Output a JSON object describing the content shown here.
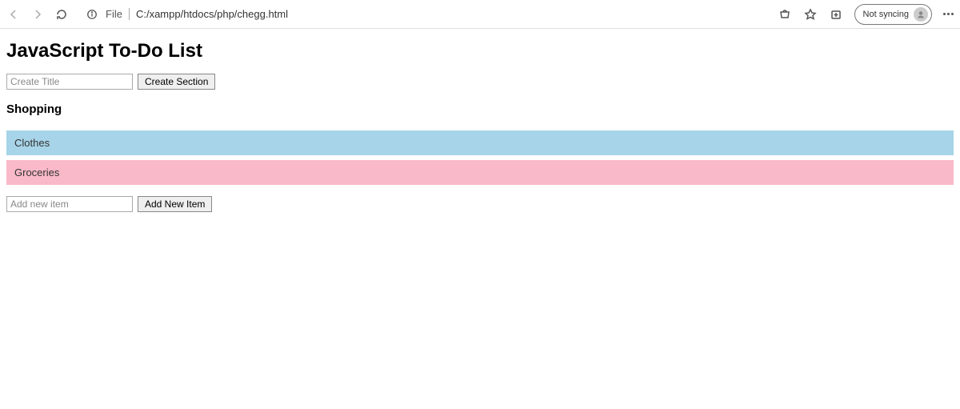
{
  "browser": {
    "url_prefix": "File",
    "url_path": "C:/xampp/htdocs/php/chegg.html",
    "sync_label": "Not syncing"
  },
  "page": {
    "title": "JavaScript To-Do List",
    "create_title_placeholder": "Create Title",
    "create_section_button": "Create Section",
    "section_title": "Shopping",
    "items": [
      {
        "label": "Clothes",
        "color": "blue"
      },
      {
        "label": "Groceries",
        "color": "pink"
      }
    ],
    "add_item_placeholder": "Add new item",
    "add_item_button": "Add New Item"
  }
}
